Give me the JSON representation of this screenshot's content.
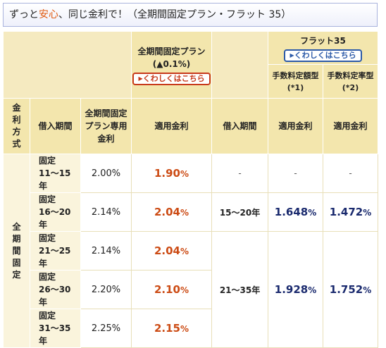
{
  "header": {
    "prefix": "ずっと",
    "highlight": "安心",
    "suffix": "、同じ金利で！（全期間固定プラン・フラット 35）"
  },
  "table": {
    "plan_title_line1": "全期間固定プラン",
    "plan_title_line2": "(▲0.1%)",
    "plan_detail_link": "くわしくはこちら",
    "flat35_title": "フラット35",
    "flat35_detail_link": "くわしくはこちら",
    "flat35_col_a": "手数料定額型 (*1)",
    "flat35_col_b": "手数料定率型 (*2)",
    "col_method": "金利方式",
    "col_period": "借入期間",
    "col_basic_rate": "全期間固定プラン専用金利",
    "col_applied_rate": "適用金利",
    "col_flat_period": "借入期間",
    "col_flat_rate_a": "適用金利",
    "col_flat_rate_b": "適用金利",
    "method_label": "全期間固定",
    "rows": [
      {
        "period": "固定11〜15年",
        "basic": "2.00%",
        "applied": "1.90",
        "pct": "%"
      },
      {
        "period": "固定16〜20年",
        "basic": "2.14%",
        "applied": "2.04",
        "pct": "%"
      },
      {
        "period": "固定21〜25年",
        "basic": "2.14%",
        "applied": "2.04",
        "pct": "%"
      },
      {
        "period": "固定26〜30年",
        "basic": "2.20%",
        "applied": "2.10",
        "pct": "%"
      },
      {
        "period": "固定31〜35年",
        "basic": "2.25%",
        "applied": "2.15",
        "pct": "%"
      }
    ],
    "flat_rows": [
      {
        "period": "-",
        "rate_a": "-",
        "rate_a_pct": "",
        "rate_b": "-",
        "rate_b_pct": ""
      },
      {
        "period": "15〜20年",
        "rate_a": "1.648",
        "rate_a_pct": "%",
        "rate_b": "1.472",
        "rate_b_pct": "%"
      },
      {
        "period": "21〜35年",
        "rate_a": "1.928",
        "rate_a_pct": "%",
        "rate_b": "1.752",
        "rate_b_pct": "%"
      }
    ]
  }
}
